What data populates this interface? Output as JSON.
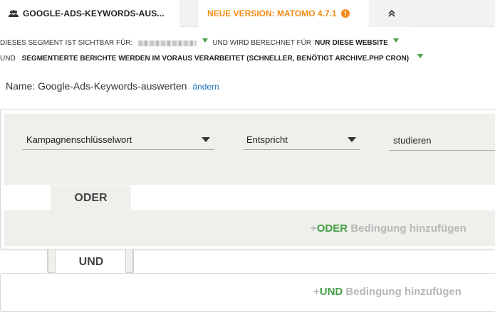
{
  "tabs": {
    "segment_label": "GOOGLE-ADS-KEYWORDS-AUS...",
    "segment_icon": "users-icon",
    "version_label": "NEUE VERSION: MATOMO 4.7.1",
    "version_icon": "info-icon",
    "collapse_icon": "double-chevron-up-icon"
  },
  "visibility": {
    "visible_prefix": "DIESES SEGMENT IST SICHTBAR FÜR:",
    "computed_prefix": "UND WIRD BERECHNET FÜR",
    "computed_value": "NUR DIESE WEBSITE",
    "processing_prefix": "UND",
    "processing_value": "SEGMENTIERTE BERICHTE WERDEN IM VORAUS VERARBEITET (SCHNELLER, BENÖTIGT ARCHIVE.PHP CRON)"
  },
  "segment_name": {
    "text": "Name: Google-Ads-Keywords-auswerten",
    "edit_label": "ändern"
  },
  "condition": {
    "dimension": "Kampagnenschlüsselwort",
    "operator": "Entspricht",
    "value": "studieren"
  },
  "or_block": {
    "label": "ODER",
    "add_plus": "+",
    "add_keyword": "ODER",
    "add_suffix": " Bedingung hinzufügen"
  },
  "and_block": {
    "label": "UND",
    "add_plus": "+",
    "add_keyword": "UND",
    "add_suffix": " Bedingung hinzufügen"
  },
  "colors": {
    "accent_green": "#43a047",
    "version_orange": "#f38b16",
    "link_blue": "#1e73be"
  }
}
